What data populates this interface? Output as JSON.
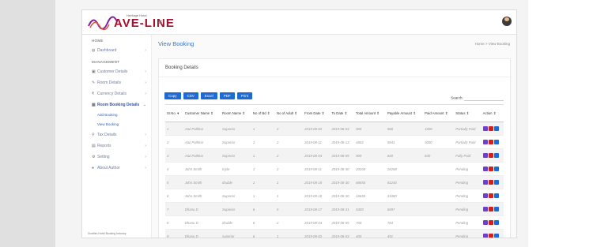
{
  "brand": {
    "logo_text": "AVE-LINE",
    "logo_tagline": "Heritage Hotel"
  },
  "sidebar": {
    "home_heading": "HOME",
    "management_heading": "MANAGEMENT",
    "items": [
      {
        "label": "Dashboard"
      },
      {
        "label": "Customer Details"
      },
      {
        "label": "Room Details"
      },
      {
        "label": "Currency Details"
      },
      {
        "label": "Room Booking Details"
      },
      {
        "label": "Tax Details"
      },
      {
        "label": "Reports"
      },
      {
        "label": "Setting"
      },
      {
        "label": "About Author"
      }
    ],
    "sub_items": [
      {
        "label": "Add Booking"
      },
      {
        "label": "View Booking"
      }
    ],
    "footer": "Scottish Hotel Booking Industry"
  },
  "header": {
    "page_title": "View Booking",
    "breadcrumb": "Home  >  View Booking"
  },
  "card": {
    "title": "Booking Details",
    "export_buttons": [
      "Copy",
      "CSV",
      "Excel",
      "PDF",
      "Print"
    ],
    "search_label": "Search:"
  },
  "table": {
    "columns": [
      "Sr.No.",
      "Customer Name",
      "Room Name",
      "No of Bd",
      "No of Adult",
      "From Date",
      "To Date",
      "Total Amount",
      "Payable Amount",
      "Paid Amount",
      "Status",
      "Action"
    ],
    "rows": [
      [
        "1",
        "Atul Pathkar",
        "Superior",
        "1",
        "2",
        "2019-08-02",
        "2019-08-03",
        "900",
        "968",
        "1000",
        "Partially Paid"
      ],
      [
        "2",
        "Atul Pathkar",
        "Superior",
        "1",
        "2",
        "2019-08-11",
        "2019-08-13",
        "4802",
        "5841",
        "5000",
        "Partially Paid"
      ],
      [
        "3",
        "Atul Pathkar",
        "Superior",
        "1",
        "2",
        "2019-08-04",
        "2019-08-05",
        "900",
        "840",
        "840",
        "Fully Paid"
      ],
      [
        "4",
        "John Smith",
        "triple",
        "1",
        "2",
        "2019-08-11",
        "2019-08-30",
        "20200",
        "26268",
        "",
        "Pending"
      ],
      [
        "5",
        "John Smith",
        "double",
        "1",
        "1",
        "2019-08-18",
        "2019-08-30",
        "68650",
        "81240",
        "",
        "Pending"
      ],
      [
        "6",
        "John Smith",
        "Superior",
        "1",
        "1",
        "2019-08-18",
        "2019-08-30",
        "16650",
        "31080",
        "",
        "Pending"
      ],
      [
        "7",
        "Dhanu D",
        "Superior",
        "6",
        "5",
        "2019-08-17",
        "2019-08-31",
        "5300",
        "6697",
        "",
        "Pending"
      ],
      [
        "8",
        "Dhanu D",
        "double",
        "6",
        "2",
        "2019-08-04",
        "2019-08-05",
        "700",
        "784",
        "",
        "Pending"
      ],
      [
        "9",
        "Dhanu D",
        "superior",
        "6",
        "1",
        "2019-08-02",
        "2019-08-03",
        "400",
        "491",
        "",
        "Pending"
      ]
    ]
  },
  "colors": {
    "primary": "#1f6ad3",
    "edit": "#6a3fd6",
    "delete": "#d21e1e",
    "brand": "#a1122e"
  }
}
